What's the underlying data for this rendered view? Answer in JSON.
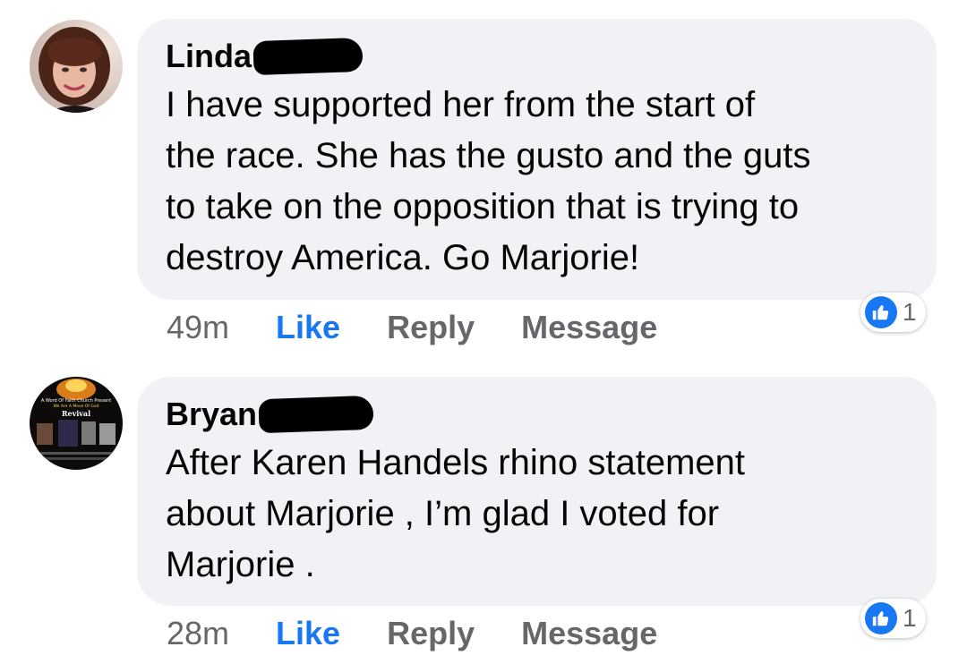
{
  "comments": [
    {
      "author": "Linda",
      "text_lines": [
        "I have supported her from the start of",
        "the race. She has the gusto and the guts",
        "to take on the opposition that is trying to",
        "destroy America. Go Marjorie!"
      ],
      "time": "49m",
      "like_label": "Like",
      "reply_label": "Reply",
      "message_label": "Message",
      "reaction_icon": "like-icon",
      "reaction_count": "1"
    },
    {
      "author": "Bryan",
      "text_lines": [
        "After Karen Handels  rhino statement",
        "about Marjorie , I’m glad I voted for",
        "Marjorie ."
      ],
      "time": "28m",
      "like_label": "Like",
      "reply_label": "Reply",
      "message_label": "Message",
      "reaction_icon": "like-icon",
      "reaction_count": "1"
    }
  ],
  "colors": {
    "bubble": "#f0f2f5",
    "like_blue": "#1877f2",
    "muted": "#65676b"
  },
  "avatar_text": [
    "A Word Of Faith Church Present",
    "We Are A Move Of God",
    "Revival"
  ]
}
